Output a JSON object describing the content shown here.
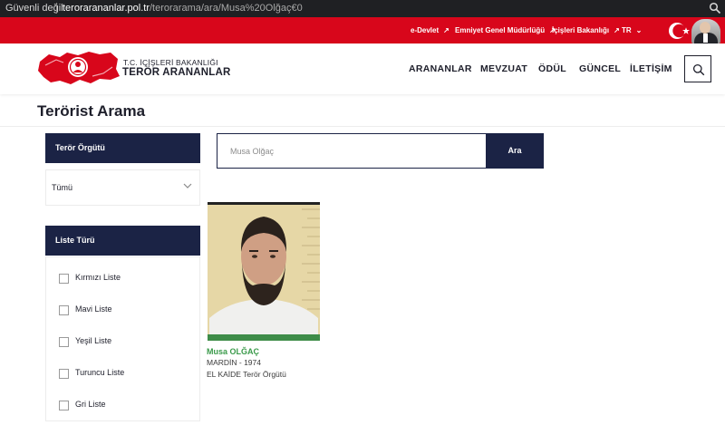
{
  "browser": {
    "security_label": "Güvenli değil",
    "url_host": "terorarananlar.pol.tr",
    "url_path": "/terorarama/ara/Musa%20Olğaç€0",
    "zoom_icon": "zoom-icon"
  },
  "top_links": [
    {
      "label": "e-Devlet",
      "icon": "external-link-icon"
    },
    {
      "label": "Emniyet Genel Müdürlüğü",
      "icon": "external-link-icon"
    },
    {
      "label": "İçişleri Bakanlığı",
      "icon": "external-link-icon"
    },
    {
      "label": "TR",
      "icon": "chevron-down-icon"
    }
  ],
  "logo": {
    "line1": "T.C. İÇİŞLERİ BAKANLIĞI",
    "line2": "TERÖR ARANANLAR"
  },
  "nav": [
    "ARANANLAR",
    "MEVZUAT",
    "ÖDÜL",
    "GÜNCEL",
    "İLETİŞİM"
  ],
  "page_title": "Terörist Arama",
  "filters": {
    "org_header": "Terör Örgütü",
    "org_selected": "Tümü",
    "list_header": "Liste Türü",
    "lists": [
      "Kırmızı Liste",
      "Mavi Liste",
      "Yeşil Liste",
      "Turuncu Liste",
      "Gri Liste"
    ]
  },
  "search": {
    "placeholder": "Musa Olğaç",
    "button": "Ara"
  },
  "results": [
    {
      "name": "Musa OLĞAÇ",
      "birth": "MARDİN - 1974",
      "organization": "EL KAİDE Terör Örgütü"
    }
  ],
  "colors": {
    "brand_red": "#d8061b",
    "navy": "#1b2345",
    "name_green": "#3a9a4a"
  }
}
